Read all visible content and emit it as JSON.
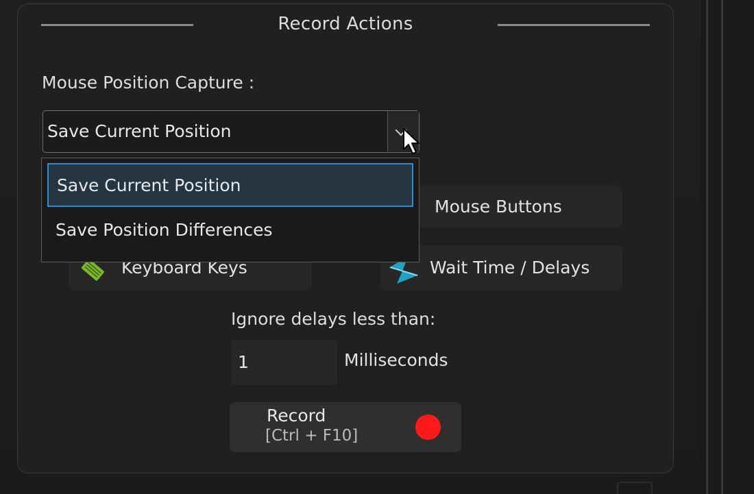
{
  "panel": {
    "title": "Record Actions"
  },
  "capture": {
    "label": "Mouse Position Capture :",
    "selected_value": "Save Current Position",
    "options": [
      "Save Current Position",
      "Save Position Differences"
    ]
  },
  "record_options": {
    "mouse_buttons": "Mouse Buttons",
    "keyboard_keys": "Keyboard Keys",
    "wait_time": "Wait Time / Delays"
  },
  "delays": {
    "label": "Ignore delays less than:",
    "value": "1",
    "unit": "Milliseconds"
  },
  "record": {
    "label": "Record",
    "shortcut": "[Ctrl + F10]"
  },
  "colors": {
    "accent": "#2c8fd4",
    "record_dot": "#ff1a1a",
    "keyboard_icon": "#7ab82a",
    "wait_icon": "#1fa3c4"
  },
  "icons": {
    "dropdown": "chevron-down-icon",
    "keyboard": "keyboard-icon",
    "wait": "hourglass-icon",
    "record": "record-dot-icon",
    "cursor": "mouse-cursor-icon"
  }
}
